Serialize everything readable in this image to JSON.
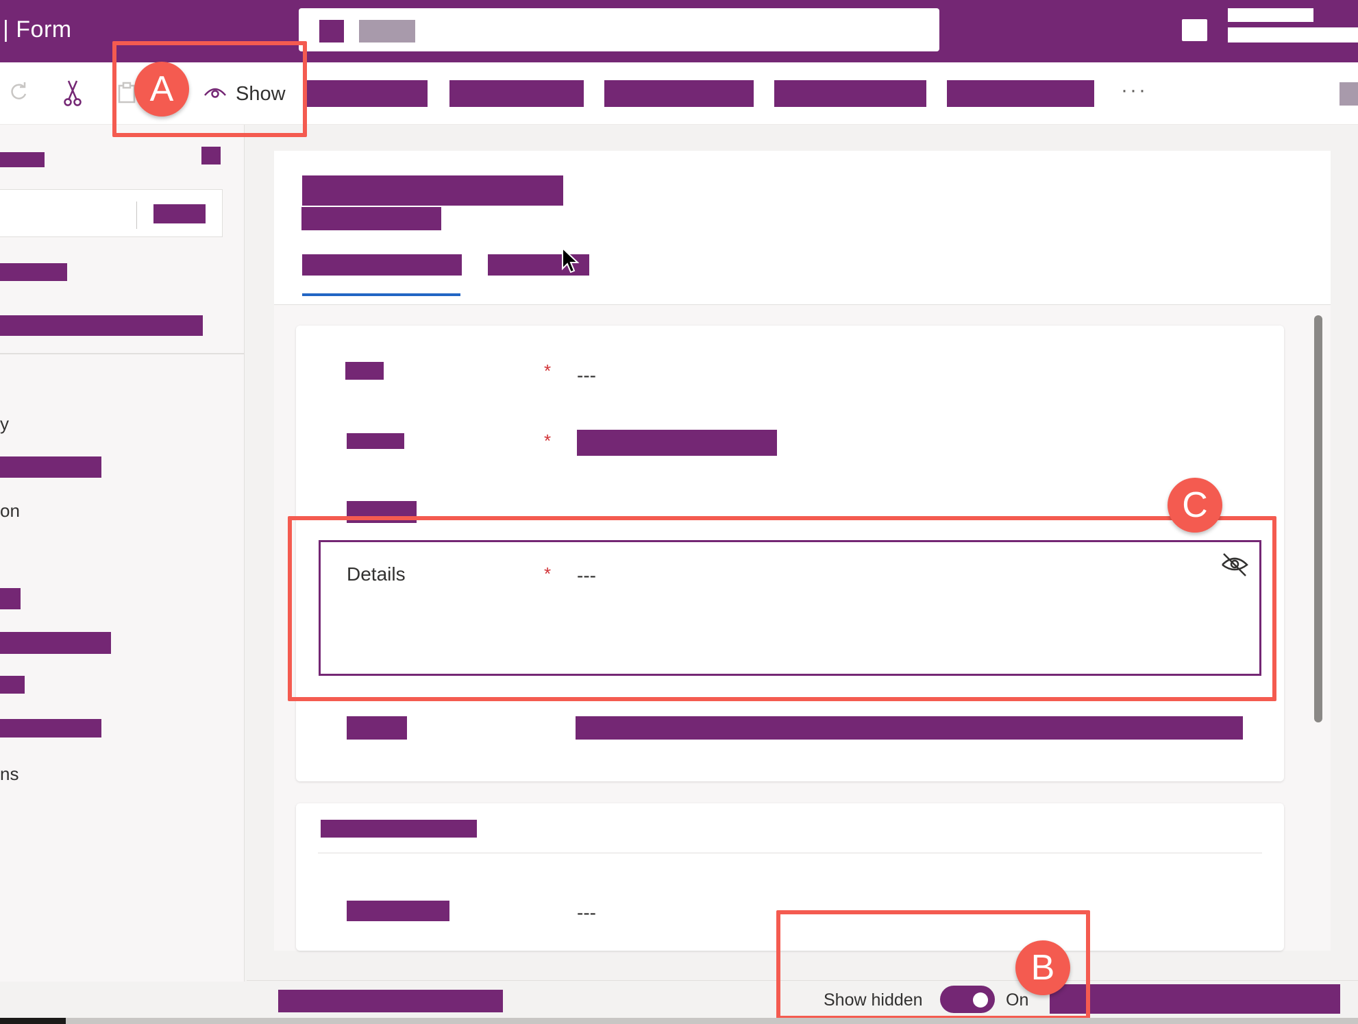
{
  "header": {
    "app_title": "|  Form"
  },
  "command_bar": {
    "show_label": "Show",
    "more_label": "···",
    "icons": [
      "redo-icon",
      "cut-icon",
      "paste-icon",
      "eye-icon"
    ]
  },
  "left_nav": {
    "partial_items": [
      "y",
      "on",
      "ns"
    ]
  },
  "form": {
    "fields": [
      {
        "required": "*",
        "value": "---"
      },
      {
        "required": "*"
      },
      {},
      {
        "label": "Details",
        "required": "*",
        "value": "---",
        "hidden_icon": "eye-off-icon"
      },
      {}
    ],
    "section2_field_value": "---"
  },
  "footer": {
    "show_hidden_label": "Show hidden",
    "toggle_state": "On"
  },
  "callouts": {
    "a": "A",
    "b": "B",
    "c": "C"
  },
  "colors": {
    "brand": "#742774",
    "callout": "#f45b50",
    "required": "#d13438",
    "tab_underline": "#2266c4"
  }
}
